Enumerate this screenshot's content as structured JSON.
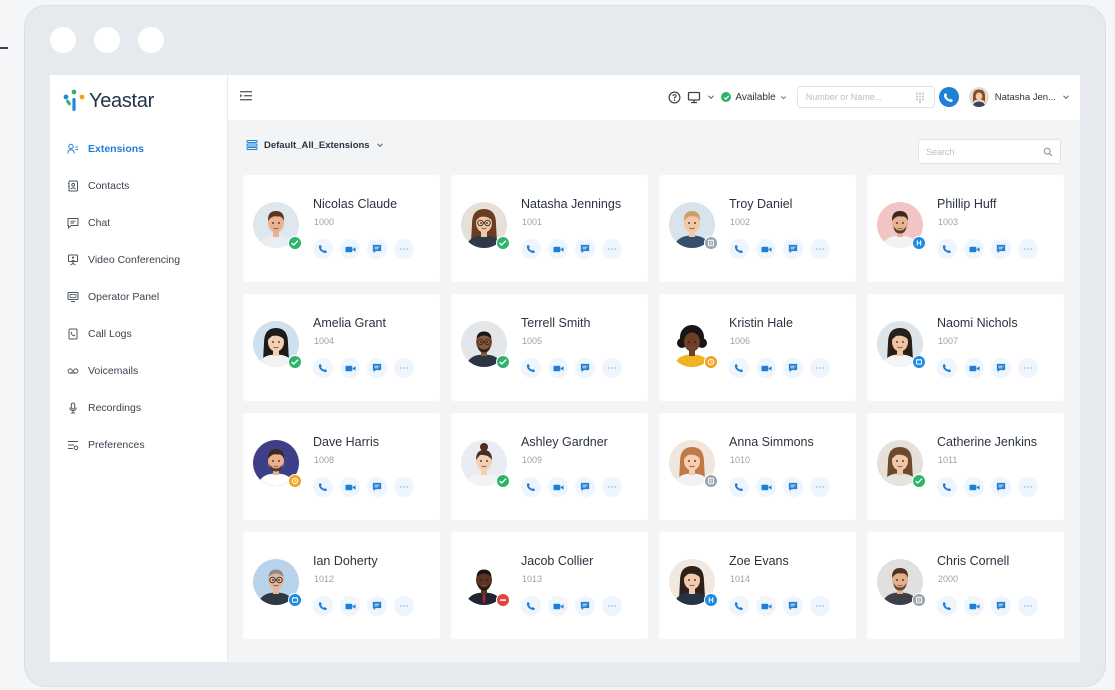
{
  "app": {
    "brand": "Yeastar"
  },
  "sidebar": {
    "items": [
      {
        "label": "Extensions",
        "icon": "extensions-icon",
        "active": true
      },
      {
        "label": "Contacts",
        "icon": "contacts-icon"
      },
      {
        "label": "Chat",
        "icon": "chat-icon"
      },
      {
        "label": "Video Conferencing",
        "icon": "video-conferencing-icon"
      },
      {
        "label": "Operator Panel",
        "icon": "operator-panel-icon"
      },
      {
        "label": "Call Logs",
        "icon": "call-logs-icon"
      },
      {
        "label": "Voicemails",
        "icon": "voicemail-icon"
      },
      {
        "label": "Recordings",
        "icon": "recordings-icon"
      },
      {
        "label": "Preferences",
        "icon": "preferences-icon"
      }
    ]
  },
  "topbar": {
    "status": "Available",
    "dial_placeholder": "Number or Name...",
    "user_name": "Natasha Jen..."
  },
  "filter": {
    "label": "Default_All_Extensions"
  },
  "search": {
    "placeholder": "Search"
  },
  "colors": {
    "accent": "#1f7fd6",
    "available": "#2fb36a",
    "away": "#f4a11a",
    "busy": "#e0453a",
    "offline": "#9aa3ab",
    "dnd": "#1f8be0"
  },
  "extensions": [
    {
      "name": "Nicolas Claude",
      "number": "1000",
      "presence": "available"
    },
    {
      "name": "Natasha Jennings",
      "number": "1001",
      "presence": "available"
    },
    {
      "name": "Troy Daniel",
      "number": "1002",
      "presence": "offline"
    },
    {
      "name": "Phillip Huff",
      "number": "1003",
      "presence": "dnd"
    },
    {
      "name": "Amelia Grant",
      "number": "1004",
      "presence": "available"
    },
    {
      "name": "Terrell Smith",
      "number": "1005",
      "presence": "available"
    },
    {
      "name": "Kristin Hale",
      "number": "1006",
      "presence": "away"
    },
    {
      "name": "Naomi Nichols",
      "number": "1007",
      "presence": "in-meeting"
    },
    {
      "name": "Dave Harris",
      "number": "1008",
      "presence": "away"
    },
    {
      "name": "Ashley Gardner",
      "number": "1009",
      "presence": "available"
    },
    {
      "name": "Anna Simmons",
      "number": "1010",
      "presence": "offline"
    },
    {
      "name": "Catherine Jenkins",
      "number": "1011",
      "presence": "available"
    },
    {
      "name": "Ian Doherty",
      "number": "1012",
      "presence": "in-meeting"
    },
    {
      "name": "Jacob Collier",
      "number": "1013",
      "presence": "busy"
    },
    {
      "name": "Zoe Evans",
      "number": "1014",
      "presence": "dnd"
    },
    {
      "name": "Chris Cornell",
      "number": "2000",
      "presence": "offline"
    }
  ]
}
